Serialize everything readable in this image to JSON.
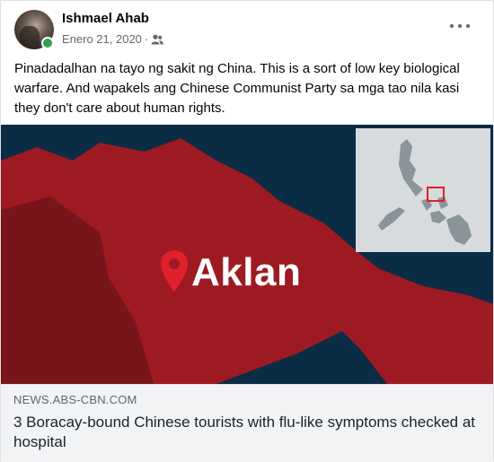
{
  "post": {
    "author_name": "Ishmael Ahab",
    "date": "Enero 21, 2020",
    "separator": "·",
    "audience_icon": "friends-icon",
    "more_icon": "more-options-icon",
    "text": "Pinadadalhan na tayo ng sakit ng China. This is a sort of low key biological warfare. And wapakels ang Chinese Communist Party sa mga tao nila kasi they don't care about human rights."
  },
  "link_preview": {
    "image_label": "Aklan",
    "pin_icon": "location-pin-icon",
    "domain": "NEWS.ABS-CBN.COM",
    "title": "3 Boracay-bound Chinese tourists with flu-like symptoms checked at hospital"
  },
  "colors": {
    "map_red": "#9e1a22",
    "sea_blue": "#0b2c45",
    "pin_red": "#e0202a",
    "online_green": "#31a24c"
  }
}
